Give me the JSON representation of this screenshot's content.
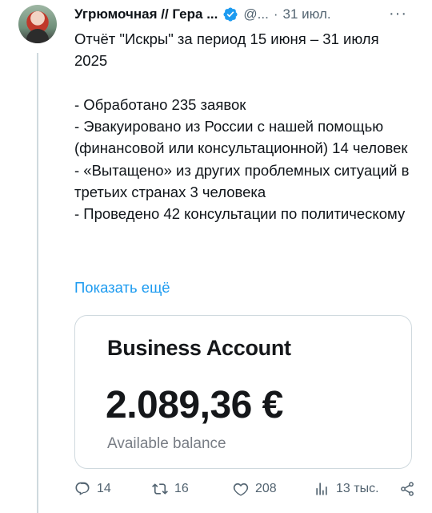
{
  "author": {
    "name": "Угрюмочная // Гера ...",
    "handle": "@...",
    "separator": "·",
    "date": "31 июл."
  },
  "more_label": "···",
  "tweet": {
    "text": "Отчёт \"Искры\" за период 15 июня – 31 июля 2025\n\n- Обработано 235 заявок\n- Эвакуировано из России с нашей помощью (финансовой или консультационной) 14 человек\n- «Вытащено» из других проблемных ситуаций в третьих странах 3 человека\n- Проведено 42 консультации по политическому",
    "show_more": "Показать ещё"
  },
  "card": {
    "title": "Business Account",
    "balance": "2.089,36 €",
    "caption": "Available balance"
  },
  "actions": {
    "replies": "14",
    "retweets": "16",
    "likes": "208",
    "views": "13 тыс."
  },
  "colors": {
    "accent": "#1d9bf0",
    "text": "#0f1419",
    "muted": "#536471",
    "border": "#cfd9de"
  }
}
